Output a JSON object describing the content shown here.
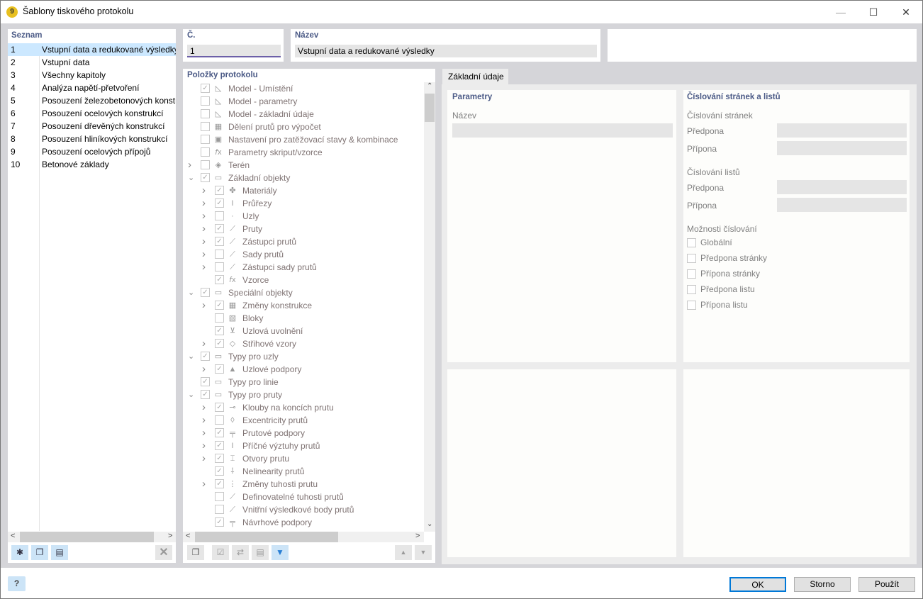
{
  "window": {
    "title": "Šablony tiskového protokolu",
    "minimize": "—",
    "maximize": "☐",
    "close": "✕"
  },
  "list": {
    "header": "Seznam",
    "items": [
      {
        "no": "1",
        "name": "Vstupní data a redukované výsledky",
        "selected": true
      },
      {
        "no": "2",
        "name": "Vstupní data"
      },
      {
        "no": "3",
        "name": "Všechny kapitoly"
      },
      {
        "no": "4",
        "name": "Analýza napětí-přetvoření"
      },
      {
        "no": "5",
        "name": "Posouzení železobetonových konstrukcí"
      },
      {
        "no": "6",
        "name": "Posouzení ocelových konstrukcí"
      },
      {
        "no": "7",
        "name": "Posouzení dřevěných konstrukcí"
      },
      {
        "no": "8",
        "name": "Posouzení hliníkových konstrukcí"
      },
      {
        "no": "9",
        "name": "Posouzení ocelových přípojů"
      },
      {
        "no": "10",
        "name": "Betonové základy"
      }
    ],
    "toolbar": {
      "new": "new-template-icon",
      "copy": "copy-template-icon",
      "import": "import-from-database-icon",
      "delete": "✕"
    }
  },
  "number": {
    "label": "Č.",
    "value": "1"
  },
  "name": {
    "label": "Název",
    "value": "Vstupní data a redukované výsledky"
  },
  "tree": {
    "header": "Položky protokolu",
    "items": [
      {
        "label": "Model - Umístění",
        "level": 0,
        "exp": "",
        "checked": true,
        "icon": "model-icon"
      },
      {
        "label": "Model - parametry",
        "level": 0,
        "exp": "",
        "checked": false,
        "icon": "model-icon"
      },
      {
        "label": "Model - základní údaje",
        "level": 0,
        "exp": "",
        "checked": false,
        "icon": "model-icon"
      },
      {
        "label": "Dělení prutů pro výpočet",
        "level": 0,
        "exp": "",
        "checked": false,
        "icon": "grid-icon"
      },
      {
        "label": "Nastavení pro zatěžovací stavy & kombinace",
        "level": 0,
        "exp": "",
        "checked": false,
        "icon": "settings-icon"
      },
      {
        "label": "Parametry skriput/vzorce",
        "level": 0,
        "exp": "",
        "checked": false,
        "icon": "fx-icon"
      },
      {
        "label": "Terén",
        "level": 0,
        "exp": ">",
        "checked": false,
        "icon": "terrain-icon"
      },
      {
        "label": "Základní objekty",
        "level": 0,
        "exp": "v",
        "checked": true,
        "icon": "folder-icon"
      },
      {
        "label": "Materiály",
        "level": 1,
        "exp": ">",
        "checked": true,
        "icon": "materials-icon"
      },
      {
        "label": "Průřezy",
        "level": 1,
        "exp": ">",
        "checked": true,
        "icon": "section-icon"
      },
      {
        "label": "Uzly",
        "level": 1,
        "exp": ">",
        "checked": false,
        "icon": "node-icon"
      },
      {
        "label": "Pruty",
        "level": 1,
        "exp": ">",
        "checked": true,
        "icon": "member-icon"
      },
      {
        "label": "Zástupci prutů",
        "level": 1,
        "exp": ">",
        "checked": true,
        "icon": "member-rep-icon"
      },
      {
        "label": "Sady prutů",
        "level": 1,
        "exp": ">",
        "checked": false,
        "icon": "member-set-icon"
      },
      {
        "label": "Zástupci sady prutů",
        "level": 1,
        "exp": ">",
        "checked": false,
        "icon": "member-set-rep-icon"
      },
      {
        "label": "Vzorce",
        "level": 1,
        "exp": "",
        "checked": true,
        "icon": "fx-icon"
      },
      {
        "label": "Speciální objekty",
        "level": 0,
        "exp": "v",
        "checked": true,
        "icon": "folder-icon"
      },
      {
        "label": "Změny konstrukce",
        "level": 1,
        "exp": ">",
        "checked": true,
        "icon": "grid-icon"
      },
      {
        "label": "Bloky",
        "level": 1,
        "exp": "",
        "checked": false,
        "icon": "blocks-icon"
      },
      {
        "label": "Uzlová uvolnění",
        "level": 1,
        "exp": "",
        "checked": true,
        "icon": "nodal-release-icon"
      },
      {
        "label": "Střihové vzory",
        "level": 1,
        "exp": ">",
        "checked": true,
        "icon": "cutting-pattern-icon"
      },
      {
        "label": "Typy pro uzly",
        "level": 0,
        "exp": "v",
        "checked": true,
        "icon": "folder-icon"
      },
      {
        "label": "Uzlové podpory",
        "level": 1,
        "exp": ">",
        "checked": true,
        "icon": "nodal-support-icon"
      },
      {
        "label": "Typy pro linie",
        "level": 0,
        "exp": "",
        "checked": true,
        "icon": "folder-icon"
      },
      {
        "label": "Typy pro pruty",
        "level": 0,
        "exp": "v",
        "checked": true,
        "icon": "folder-icon"
      },
      {
        "label": "Klouby na koncích prutu",
        "level": 1,
        "exp": ">",
        "checked": true,
        "icon": "hinge-icon"
      },
      {
        "label": "Excentricity prutů",
        "level": 1,
        "exp": ">",
        "checked": false,
        "icon": "eccentricity-icon"
      },
      {
        "label": "Prutové podpory",
        "level": 1,
        "exp": ">",
        "checked": true,
        "icon": "member-support-icon"
      },
      {
        "label": "Příčné výztuhy prutů",
        "level": 1,
        "exp": ">",
        "checked": true,
        "icon": "stiffener-icon"
      },
      {
        "label": "Otvory prutu",
        "level": 1,
        "exp": ">",
        "checked": true,
        "icon": "opening-icon"
      },
      {
        "label": "Nelinearity prutů",
        "level": 1,
        "exp": "",
        "checked": true,
        "icon": "nonlinearity-icon"
      },
      {
        "label": "Změny tuhosti prutu",
        "level": 1,
        "exp": ">",
        "checked": true,
        "icon": "stiffness-icon"
      },
      {
        "label": "Definovatelné tuhosti prutů",
        "level": 1,
        "exp": "",
        "checked": false,
        "icon": "definable-stiffness-icon"
      },
      {
        "label": "Vnitřní výsledkové body prutů",
        "level": 1,
        "exp": "",
        "checked": false,
        "icon": "result-points-icon"
      },
      {
        "label": "Návrhové podpory",
        "level": 1,
        "exp": "",
        "checked": true,
        "icon": "design-support-icon"
      }
    ]
  },
  "tab": {
    "label": "Základní údaje"
  },
  "params": {
    "header": "Parametry",
    "name_label": "Název",
    "name_value": ""
  },
  "numbering": {
    "header": "Číslování stránek a listů",
    "pages": "Číslování stránek",
    "sheets": "Číslování listů",
    "prefix": "Předpona",
    "suffix": "Přípona",
    "options": "Možnosti číslování",
    "checkboxes": [
      {
        "label": "Globální",
        "checked": false
      },
      {
        "label": "Předpona stránky",
        "checked": false
      },
      {
        "label": "Přípona stránky",
        "checked": false
      },
      {
        "label": "Předpona listu",
        "checked": false
      },
      {
        "label": "Přípona listu",
        "checked": false
      }
    ]
  },
  "footer": {
    "ok": "OK",
    "cancel": "Storno",
    "apply": "Použít",
    "help": "?"
  }
}
